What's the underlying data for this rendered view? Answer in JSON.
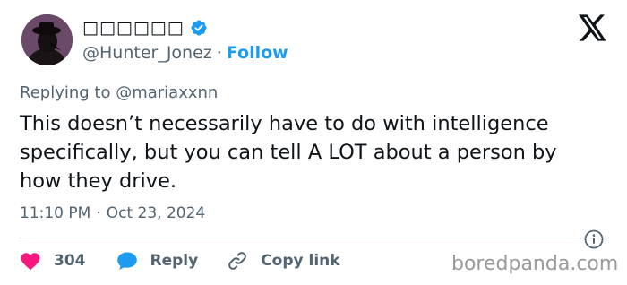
{
  "author": {
    "display_name": "□□□□□□",
    "handle": "@Hunter_Jonez",
    "separator": "·",
    "follow_label": "Follow"
  },
  "reply_context": {
    "prefix": "Replying to",
    "mention": "@mariaxxnn"
  },
  "tweet": {
    "text": "This doesn’t necessarily have to do with intelligence specifically, but you can tell A LOT about a person by how they drive.",
    "time": "11:10 PM",
    "separator": "·",
    "date": "Oct 23, 2024"
  },
  "actions": {
    "likes": "304",
    "reply_label": "Reply",
    "copy_label": "Copy link"
  },
  "watermark": "boredpanda.com",
  "icons": {
    "verified": "verified-badge-icon",
    "logo": "x-logo-icon",
    "info": "info-icon",
    "like": "heart-icon",
    "reply": "speech-bubble-icon",
    "copy": "link-icon"
  },
  "colors": {
    "text": "#0f1419",
    "secondary": "#536471",
    "accent": "#1d9bf0",
    "like": "#f91880",
    "divider": "#cfd9de"
  }
}
